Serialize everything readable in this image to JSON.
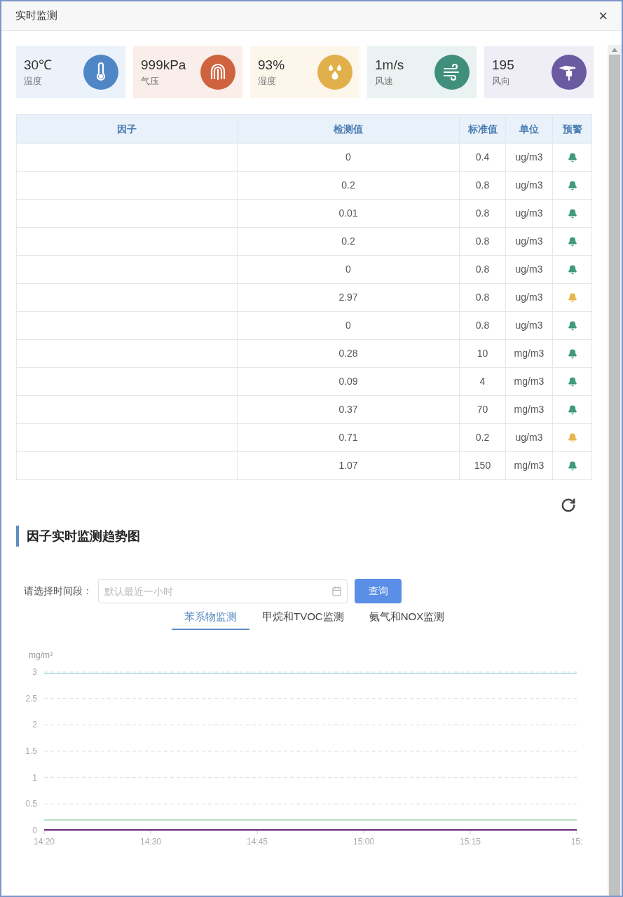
{
  "window": {
    "title": "实时监测",
    "close": "×"
  },
  "stats": [
    {
      "kind": "thermometer",
      "value": "30℃",
      "label": "温度",
      "color": "#4f86c6"
    },
    {
      "kind": "pressure",
      "value": "999kPa",
      "label": "气压",
      "color": "#cf633f"
    },
    {
      "kind": "humidity",
      "value": "93%",
      "label": "湿度",
      "color": "#e2b04a"
    },
    {
      "kind": "wind",
      "value": "1m/s",
      "label": "风速",
      "color": "#3f8f7c"
    },
    {
      "kind": "vane",
      "value": "195",
      "label": "风向",
      "color": "#6a5aa0"
    }
  ],
  "table": {
    "columns": [
      "因子",
      "检测值",
      "标准值",
      "单位",
      "预警"
    ],
    "rows": [
      {
        "value": "0",
        "standard": "0.4",
        "unit": "ug/m3",
        "alarm": false
      },
      {
        "value": "0.2",
        "standard": "0.8",
        "unit": "ug/m3",
        "alarm": false
      },
      {
        "value": "0.01",
        "standard": "0.8",
        "unit": "ug/m3",
        "alarm": false
      },
      {
        "value": "0.2",
        "standard": "0.8",
        "unit": "ug/m3",
        "alarm": false
      },
      {
        "value": "0",
        "standard": "0.8",
        "unit": "ug/m3",
        "alarm": false
      },
      {
        "value": "2.97",
        "standard": "0.8",
        "unit": "ug/m3",
        "alarm": true
      },
      {
        "value": "0",
        "standard": "0.8",
        "unit": "ug/m3",
        "alarm": false
      },
      {
        "value": "0.28",
        "standard": "10",
        "unit": "mg/m3",
        "alarm": false
      },
      {
        "value": "0.09",
        "standard": "4",
        "unit": "mg/m3",
        "alarm": false
      },
      {
        "value": "0.37",
        "standard": "70",
        "unit": "mg/m3",
        "alarm": false
      },
      {
        "value": "0.71",
        "standard": "0.2",
        "unit": "ug/m3",
        "alarm": true
      },
      {
        "value": "1.07",
        "standard": "150",
        "unit": "mg/m3",
        "alarm": false
      }
    ]
  },
  "trend": {
    "title": "因子实时监测趋势图",
    "filter_label": "请选择时间段：",
    "placeholder": "默认最近一小时",
    "query_button": "查询",
    "tabs": [
      {
        "label": "苯系物监测",
        "selected": true
      },
      {
        "label": "甲烷和TVOC监测",
        "selected": false
      },
      {
        "label": "氨气和NOX监测",
        "selected": false
      }
    ],
    "chart_data": {
      "type": "line",
      "ylabel": "mg/m³",
      "categories": [
        "14:20",
        "14:30",
        "14:45",
        "15:00",
        "15:15",
        null
      ],
      "ylim": [
        0,
        3
      ],
      "grid": true,
      "yticks": [
        {
          "value": 0,
          "label": "0"
        },
        {
          "value": 0.5,
          "label": "0.5"
        },
        {
          "value": 1,
          "label": "1"
        },
        {
          "value": 1.5,
          "label": "1.5"
        },
        {
          "value": 2,
          "label": "2"
        },
        {
          "value": 2.5,
          "label": "2.5"
        },
        {
          "value": 3,
          "label": "3"
        }
      ],
      "series": [
        {
          "color": "#a8dde6",
          "values": [
            2.97,
            2.97,
            2.97,
            2.97,
            2.97,
            2.97
          ]
        },
        {
          "color": "#9fd8a6",
          "values": [
            0.2,
            0.2,
            0.2,
            0.2,
            0.2,
            0.2
          ]
        },
        {
          "color": "#7b3f86",
          "values": [
            0.01,
            0.01,
            0.01,
            0.01,
            0.01,
            0.01
          ]
        }
      ]
    },
    "edge_tick_text": "15:"
  }
}
